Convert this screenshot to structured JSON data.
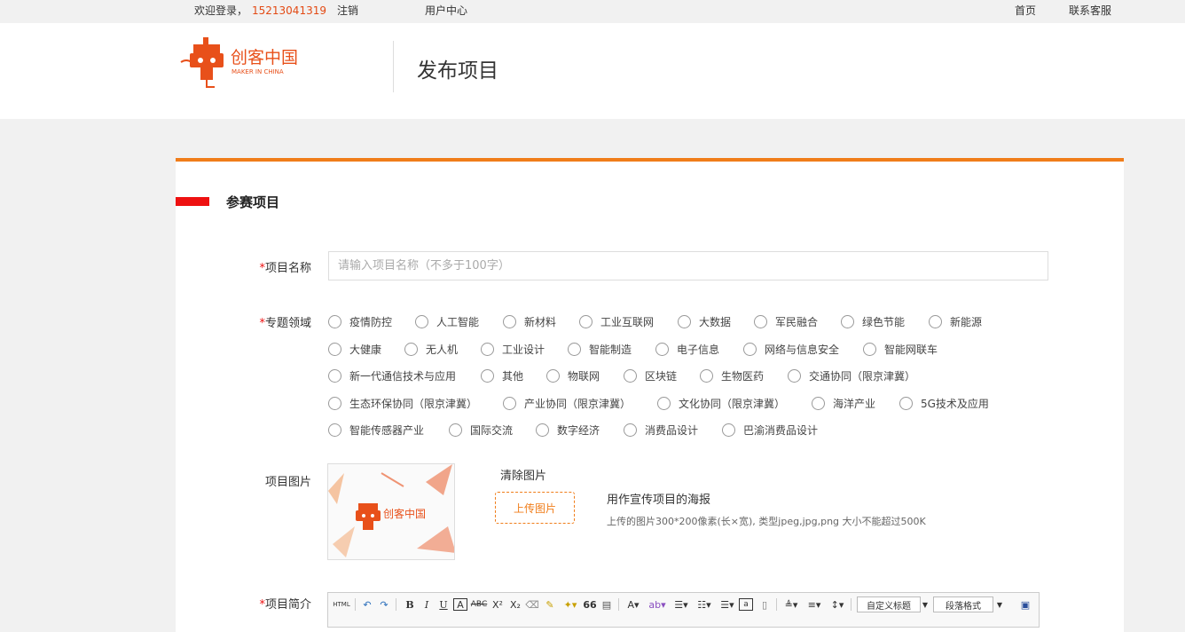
{
  "topbar": {
    "welcome": "欢迎登录，",
    "phone": "15213041319",
    "logout": "注销",
    "user_center": "用户中心",
    "home": "首页",
    "support": "联系客服"
  },
  "header": {
    "logo_text": "创客中国",
    "logo_sub": "MAKER IN CHINA",
    "title": "发布项目"
  },
  "section": {
    "title": "参赛项目"
  },
  "form": {
    "name": {
      "required": "*",
      "label": "项目名称",
      "placeholder": "请输入项目名称（不多于100字）",
      "value": ""
    },
    "field": {
      "required": "*",
      "label": "专题领域",
      "options": [
        "疫情防控",
        "人工智能",
        "新材料",
        "工业互联网",
        "大数据",
        "军民融合",
        "绿色节能",
        "新能源",
        "大健康",
        "无人机",
        "工业设计",
        "智能制造",
        "电子信息",
        "网络与信息安全",
        "智能网联车",
        "新一代通信技术与应用",
        "其他",
        "物联网",
        "区块链",
        "生物医药",
        "交通协同（限京津冀）",
        "生态环保协同（限京津冀）",
        "产业协同（限京津冀）",
        "文化协同（限京津冀）",
        "海洋产业",
        "5G技术及应用",
        "智能传感器产业",
        "国际交流",
        "数字经济",
        "消费品设计",
        "巴渝消费品设计"
      ]
    },
    "image": {
      "label": "项目图片",
      "clear": "清除图片",
      "upload": "上传图片",
      "hint_title": "用作宣传项目的海报",
      "hint_detail": "上传的图片300*200像素(长×宽), 类型jpeg,jpg,png 大小不能超过500K"
    },
    "intro": {
      "required": "*",
      "label": "项目简介",
      "toolbar": {
        "html": "HTML",
        "bold": "B",
        "italic": "I",
        "underline": "U",
        "quote": "66",
        "custom_heading": "自定义标题",
        "paragraph": "段落格式"
      }
    }
  },
  "colors": {
    "accent": "#f07d1a",
    "brand_red": "#e11",
    "section_bar": "#e11"
  }
}
